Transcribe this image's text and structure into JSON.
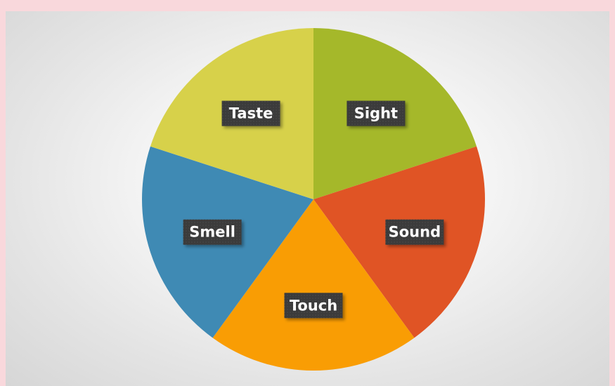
{
  "chart_data": {
    "type": "pie",
    "title": "",
    "legend": "none",
    "start_angle_deg": 0,
    "direction": "clockwise",
    "slices": [
      {
        "label": "Sight",
        "value": 1,
        "color": "#a5b82a"
      },
      {
        "label": "Sound",
        "value": 1,
        "color": "#e05425"
      },
      {
        "label": "Touch",
        "value": 1,
        "color": "#f99d04"
      },
      {
        "label": "Smell",
        "value": 1,
        "color": "#3f8ab4"
      },
      {
        "label": "Taste",
        "value": 1,
        "color": "#d7d14a"
      }
    ]
  },
  "colors": {
    "outer_border": "#f9d8dc",
    "label_box": "#3a3a3a",
    "label_text": "#ffffff"
  }
}
